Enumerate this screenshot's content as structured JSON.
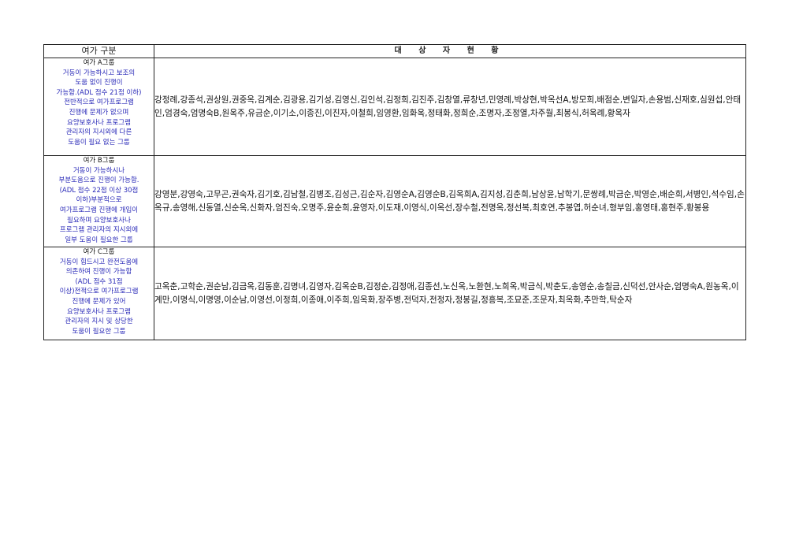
{
  "table": {
    "header_left": "여가 구분",
    "header_right": "대 상 자 현 황",
    "rows": [
      {
        "title": "여가 A그룹",
        "description": [
          "거동이 가능하시고 보조의",
          "도움 없이 진행이",
          "가능함.(ADL 점수 21점 이하)",
          "전반적으로 여가프로그램",
          "진행에 문제가 없으며",
          "요양보호사나 프로그램",
          "관리자의 지시외에 다른",
          "도움이 필요 없는 그룹"
        ],
        "names": "강정례,강종석,권상원,권중옥,김계순,김광용,김기성,김영신,김인석,김정희,김진주,김창열,류창년,민영례,박상현,박옥선A,방모희,배점순,변일자,손용범,신재호,심원섭,안태인,엄경숙,엄명숙B,원옥주,유금순,이기소,이종진,이진자,이철희,임영환,임화옥,정태화,정희순,조명자,조정열,차주월,최봉식,허옥례,황옥자"
      },
      {
        "title": "여가 B그룹",
        "description": [
          "거동이 가능하시나",
          "부분도움으로 진행이 가능함.",
          "(ADL 점수 22점 이상 30점",
          "이하)부분적으로",
          "여가프로그램 진행에 개입이",
          "필요하며 요양보호사나",
          "프로그램 관리자의 지시외에",
          "일부 도움이 필요한 그룹"
        ],
        "names": "강영분,강영숙,고무곤,권숙자,김기호,김남철,김병조,김성근,김순자,김영순A,김영순B,김옥희A,김지성,김춘희,남상윤,남학기,문쌍례,박금순,박영순,배순희,서병인,석수임,손옥규,송영해,신동열,신순옥,신화자,엄진숙,오명주,윤순희,윤영자,이도재,이영식,이옥선,장수철,전명옥,정선복,최호연,추봉엽,허순녀,형부임,홍영태,홍현주,황봉용"
      },
      {
        "title": "여가 C그룹",
        "description": [
          "거동이 힘드시고 완전도움에",
          "의존하여 진행이 가능함",
          "(ADL 점수 31점",
          "이상)전적으로 여가프로그램",
          "진행에 문제가 있어",
          "요양보호사나 프로그램",
          "관리자의 지시 및 상당한",
          "도움이 필요한 그룹"
        ],
        "names": "고옥춘,고학순,권순남,김금옥,김동훈,김명녀,김영자,김옥순B,김정순,김정애,김종선,노신옥,노환현,노희옥,박금식,박춘도,송영순,송칠금,신덕선,안사순,엄명숙A,원농옥,이계만,이명식,이명영,이순남,이영선,이정희,이종애,이주희,임옥화,장주병,전덕자,전정자,정봉길,정흥복,조묘준,조문자,최옥화,추만학,탁순자"
      }
    ]
  },
  "colors": {
    "description_text": "#2a2ab8",
    "border": "#222222"
  }
}
